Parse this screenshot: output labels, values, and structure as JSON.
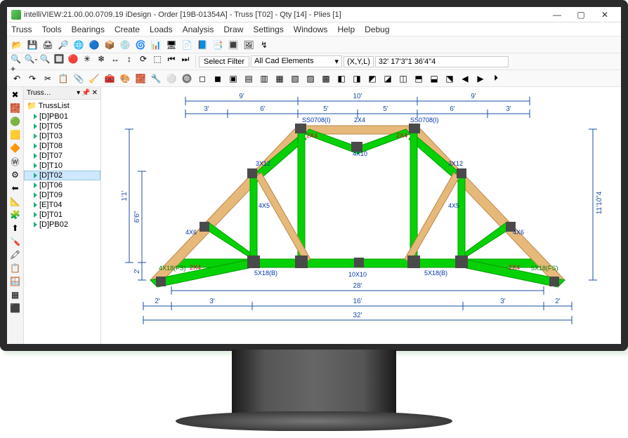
{
  "window": {
    "title": "intelliVIEW:21.00.00.0709.19 iDesign - Order [19B-01354A] - Truss [T02] - Qty [14] - Plies [1]",
    "min": "—",
    "max": "▢",
    "close": "✕"
  },
  "menus": [
    "Truss",
    "Tools",
    "Bearings",
    "Create",
    "Loads",
    "Analysis",
    "Draw",
    "Settings",
    "Windows",
    "Help",
    "Debug"
  ],
  "filter": {
    "label": "Select Filter",
    "value": "All Cad Elements"
  },
  "coords": {
    "label": "(X,Y,L)",
    "value": "32'   17'3\"1   36'4\"4"
  },
  "panel": {
    "tab": "Truss…",
    "pins": [
      "▾",
      "📌",
      "✕"
    ],
    "root": "TrussList",
    "items": [
      {
        "label": "[D]PB01"
      },
      {
        "label": "[D]T05"
      },
      {
        "label": "[D]T03"
      },
      {
        "label": "[D]T08"
      },
      {
        "label": "[D]T07"
      },
      {
        "label": "[D]T10"
      },
      {
        "label": "[D]T02",
        "selected": true
      },
      {
        "label": "[D]T06"
      },
      {
        "label": "[D]T09"
      },
      {
        "label": "[E]T04"
      },
      {
        "label": "[D]T01"
      },
      {
        "label": "[D]PB02"
      }
    ]
  },
  "side_icons": [
    "✖",
    "🧱",
    "🟢",
    "🟨",
    "🔶",
    "Ⓦ",
    "⚙",
    "⬅",
    "📐",
    "🧩",
    "⬆",
    "🪛",
    "🖍",
    "📋",
    "🪟",
    "▦",
    "⬛"
  ],
  "tb1": [
    "📂",
    "💾",
    "🖨",
    "🔎",
    "🌐",
    "🔵",
    "📦",
    "💿",
    "🌀",
    "📊",
    "🖥",
    "📄",
    "📘",
    "📑",
    "🔳",
    "🖼",
    "↯"
  ],
  "tb2_a": [
    "🔍+",
    "🔍-",
    "🔍",
    "🔲",
    "🔴",
    "✳",
    "❄",
    "↔",
    "↕",
    "⟳",
    "⬚",
    "⏮",
    "⏭"
  ],
  "tb3": [
    "↶",
    "↷",
    "✂",
    "📋",
    "📎",
    "🧹",
    "🧰",
    "🎨",
    "🧱",
    "🔧",
    "⚪",
    "🔘",
    "◻",
    "◼",
    "▣",
    "▤",
    "▥",
    "▦",
    "▧",
    "▨",
    "▩",
    "◧",
    "◨",
    "◩",
    "◪",
    "◫",
    "⬒",
    "⬓",
    "⬔",
    "◀",
    "▶",
    "⏵"
  ],
  "truss": {
    "dims_top1": [
      "9'",
      "10'",
      "9'"
    ],
    "dims_top2": [
      "3'",
      "6'",
      "5'",
      "5'",
      "6'",
      "3'"
    ],
    "dims_bottom": [
      "28'",
      "2'",
      "3'",
      "16'",
      "3'",
      "2'",
      "32'"
    ],
    "height_left": "6'6\"",
    "height_left_small": "2'",
    "height_mid": "1'1'",
    "height_right": "11'10\"4",
    "labels": {
      "ss_left": "SS0708(I)",
      "ss_right": "SS0708(I)",
      "top_mid": "2X4",
      "top_2x4a": "2X4",
      "top_2x4b": "2X4",
      "x10": "4X10",
      "x10b": "10X10",
      "x12a": "3X12",
      "x12b": "3X12",
      "x5a": "4X5",
      "x5b": "4X5",
      "x6a": "4X6",
      "x6b": "4X6",
      "x8a": "2X4",
      "x8b": "2X4",
      "x18fs": "4X18(FS)",
      "x18ba": "5X18(B)",
      "x18bb": "5X18(B)",
      "x18fs2": "5X18(FS)"
    }
  }
}
